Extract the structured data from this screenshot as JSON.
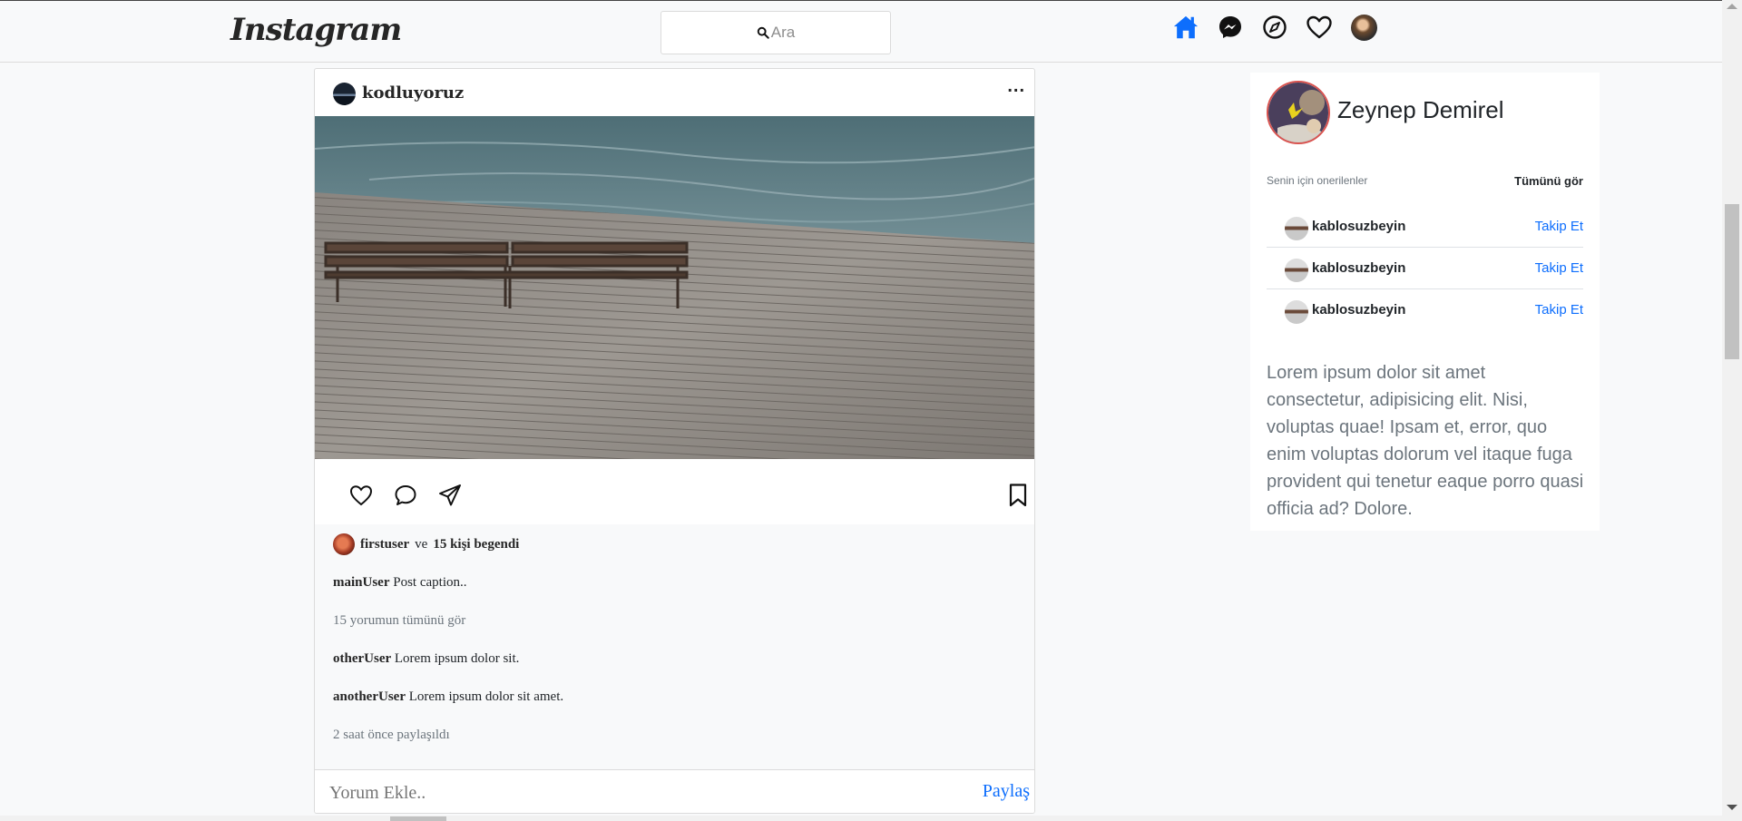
{
  "header": {
    "logo": "Instagram",
    "search_placeholder": "Ara"
  },
  "nav_icons": [
    "home-icon",
    "messenger-icon",
    "compass-icon",
    "heart-icon",
    "avatar"
  ],
  "colors": {
    "accent": "#0d6efd",
    "home_active": "#0d6efd"
  },
  "post": {
    "username": "kodluyoruz",
    "more": "...",
    "likes_user": "firstuser",
    "likes_connector": "ve",
    "likes_count": "15 kişi begendi",
    "caption_user": "mainUser",
    "caption_text": "Post caption..",
    "view_comments": "15 yorumun tümünü gör",
    "comments": [
      {
        "user": "otherUser",
        "text": "Lorem ipsum dolor sit."
      },
      {
        "user": "anotherUser",
        "text": "Lorem ipsum dolor sit amet."
      }
    ],
    "timestamp": "2 saat önce paylaşıldı",
    "comment_placeholder": "Yorum Ekle..",
    "share_label": "Paylaş"
  },
  "sidebar": {
    "profile_name": "Zeynep Demirel",
    "suggestions_title": "Senin için onerilenler",
    "see_all": "Tümünü gör",
    "suggestions": [
      {
        "name": "kablosuzbeyin",
        "action": "Takip Et"
      },
      {
        "name": "kablosuzbeyin",
        "action": "Takip Et"
      },
      {
        "name": "kablosuzbeyin",
        "action": "Takip Et"
      }
    ],
    "about_text": "Lorem ipsum dolor sit amet consectetur, adipisicing elit. Nisi, voluptas quae! Ipsam et, error, quo enim voluptas dolorum vel itaque fuga provident qui tenetur eaque porro quasi officia ad? Dolore."
  }
}
